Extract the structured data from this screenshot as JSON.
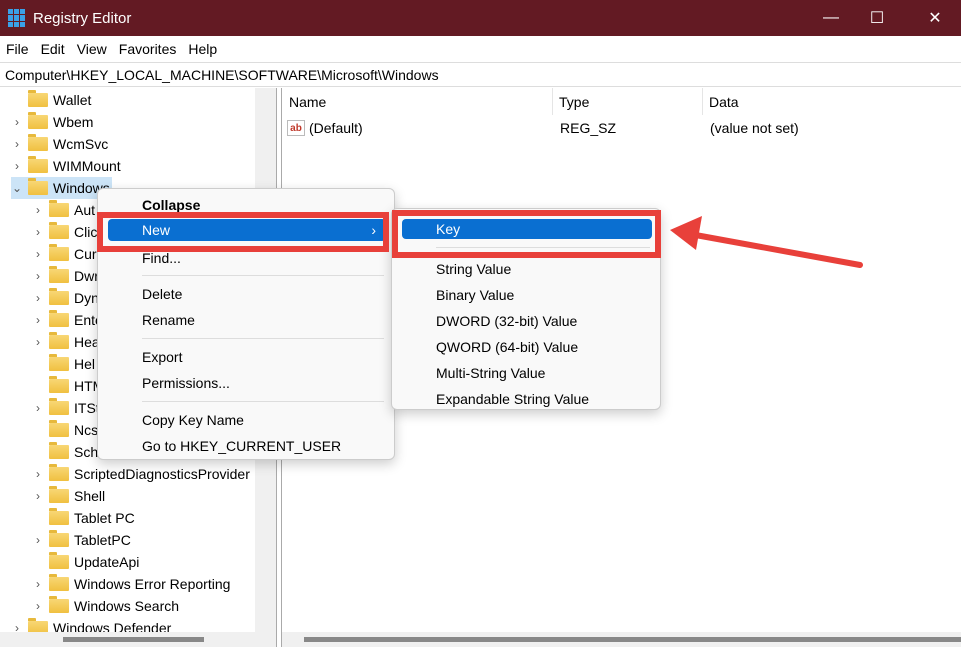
{
  "window": {
    "title": "Registry Editor",
    "minimize": "—",
    "maximize": "☐",
    "close": "✕"
  },
  "menubar": [
    "File",
    "Edit",
    "View",
    "Favorites",
    "Help"
  ],
  "address": "Computer\\HKEY_LOCAL_MACHINE\\SOFTWARE\\Microsoft\\Windows",
  "tree": [
    {
      "label": "Wallet",
      "level": 1,
      "expander": ""
    },
    {
      "label": "Wbem",
      "level": 1,
      "expander": "›"
    },
    {
      "label": "WcmSvc",
      "level": 1,
      "expander": "›"
    },
    {
      "label": "WIMMount",
      "level": 1,
      "expander": "›"
    },
    {
      "label": "Windows",
      "level": 1,
      "expander": "⌄",
      "selected": true
    },
    {
      "label": "Aut",
      "level": 2,
      "expander": "›"
    },
    {
      "label": "Clic",
      "level": 2,
      "expander": "›"
    },
    {
      "label": "Curr",
      "level": 2,
      "expander": "›"
    },
    {
      "label": "Dwr",
      "level": 2,
      "expander": "›"
    },
    {
      "label": "Dyn",
      "level": 2,
      "expander": "›"
    },
    {
      "label": "Ente",
      "level": 2,
      "expander": "›"
    },
    {
      "label": "Hea",
      "level": 2,
      "expander": "›"
    },
    {
      "label": "Hel",
      "level": 2,
      "expander": ""
    },
    {
      "label": "HTM",
      "level": 2,
      "expander": ""
    },
    {
      "label": "ITSt",
      "level": 2,
      "expander": "›"
    },
    {
      "label": "Ncs",
      "level": 2,
      "expander": ""
    },
    {
      "label": "Scho",
      "level": 2,
      "expander": ""
    },
    {
      "label": "ScriptedDiagnosticsProvider",
      "level": 2,
      "expander": "›"
    },
    {
      "label": "Shell",
      "level": 2,
      "expander": "›"
    },
    {
      "label": "Tablet PC",
      "level": 2,
      "expander": ""
    },
    {
      "label": "TabletPC",
      "level": 2,
      "expander": "›"
    },
    {
      "label": "UpdateApi",
      "level": 2,
      "expander": ""
    },
    {
      "label": "Windows Error Reporting",
      "level": 2,
      "expander": "›"
    },
    {
      "label": "Windows Search",
      "level": 2,
      "expander": "›"
    },
    {
      "label": "Windows Defender",
      "level": 1,
      "expander": "›"
    }
  ],
  "list": {
    "headers": {
      "name": "Name",
      "type": "Type",
      "data": "Data"
    },
    "rows": [
      {
        "icon": "ab",
        "name": "(Default)",
        "type": "REG_SZ",
        "data": "(value not set)"
      }
    ]
  },
  "context_menu": {
    "collapse": "Collapse",
    "new": "New",
    "new_arrow": "›",
    "find": "Find...",
    "delete": "Delete",
    "rename": "Rename",
    "export": "Export",
    "permissions": "Permissions...",
    "copy_key_name": "Copy Key Name",
    "goto": "Go to HKEY_CURRENT_USER"
  },
  "submenu": [
    "Key",
    "String Value",
    "Binary Value",
    "DWORD (32-bit) Value",
    "QWORD (64-bit) Value",
    "Multi-String Value",
    "Expandable String Value"
  ],
  "colors": {
    "titlebar": "#631a23",
    "highlight": "#0a6fd1",
    "annotation": "#e8403a"
  }
}
